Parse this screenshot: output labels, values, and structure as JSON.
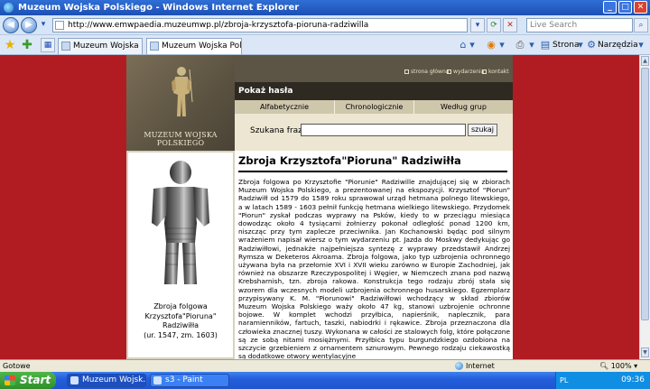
{
  "window": {
    "title": "Muzeum Wojska Polskiego - Windows Internet Explorer"
  },
  "address": {
    "url": "http://www.emwpaedia.muzeumwp.pl/zbroja-krzysztofa-pioruna-radziwilla",
    "search_placeholder": "Live Search"
  },
  "tabs": [
    {
      "label": "Muzeum Wojska Po..."
    },
    {
      "label": "Muzeum Wojska Polski..."
    }
  ],
  "toolbar": {
    "page_label": "Strona",
    "tools_label": "Narzędzia"
  },
  "site": {
    "logo_text": "MUZEUM WOJSKA POLSKIEGO",
    "top_links": [
      "strona główna",
      "wydarzenia",
      "kontakt"
    ],
    "section_header": "Pokaż hasła",
    "filters": [
      "Alfabetycznie",
      "Chronologicznie",
      "Według grup tematycznych"
    ],
    "search_label": "Szukana fraza:",
    "search_button": "szukaj",
    "image_caption_1": "Zbroja folgowa",
    "image_caption_2": "Krzysztofa\"Pioruna\" Radziwiłła",
    "image_caption_3": "(ur. 1547, zm. 1603)",
    "article_title": "Zbroja Krzysztofa\"Pioruna\" Radziwiłła",
    "article_body": "Zbroja folgowa po Krzysztofie \"Piorunie\" Radziwille znajdującej się w zbiorach Muzeum Wojska Polskiego, a prezentowanej na ekspozycji. Krzysztof \"Piorun\" Radziwiłł od 1579 do 1589 roku sprawował urząd hetmana polnego litewskiego, a w latach 1589 - 1603 pełnił funkcję hetmana wielkiego litewskiego. Przydomek \"Piorun\" zyskał podczas wyprawy na Psków, kiedy to w przeciągu miesiąca dowodząc około 4 tysiącami żołnierzy pokonał odległość ponad 1200 km, niszcząc przy tym zaplecze przeciwnika. Jan Kochanowski będąc pod silnym wrażeniem napisał wiersz o tym wydarzeniu pt. Jazda do Moskwy dedykując go Radziwiłłowi, jednakże najpełniejsza syntezę z wyprawy przedstawił Andrzej Rymsza w Deketeros Akroama. Zbroja folgowa, jako typ uzbrojenia ochronnego używana była na przełomie XVI i XVII wieku zarówno w Europie Zachodniej, jak również na obszarze Rzeczypospolitej i Węgier, w Niemczech znana pod nazwą Krebsharnish, tzn. zbroja rakowa. Konstrukcja tego rodzaju zbrój stała się wzorem dla wczesnych modeli uzbrojenia ochronnego husarskiego. Egzemplarz przypisywany K. M. \"Piorunowi\" Radziwiłłowi wchodzący w skład zbiorów Muzeum Wojska Polskiego waży około 47 kg, stanowi uzbrojenie ochronne bojowe. W komplet wchodzi przyłbica, napierśnik, naplecznik, para naramienników, fartuch, taszki, nabiodrki i rękawice. Zbroja przeznaczona dla człowieka znacznej tuszy. Wykonana w całości ze stalowych folg, które połączone są ze sobą nitami mosiężnymi. Przyłbica typu burgundzkiego ozdobiona na szczycie grzebieniem z ornamentem sznurowym. Pewnego rodzaju ciekawostką są dodatkowe otwory wentylacyjne"
  },
  "status": {
    "text": "Gotowe",
    "zone": "Internet",
    "zoom": "100%"
  },
  "taskbar": {
    "start_label": "Start",
    "tasks": [
      {
        "label": "Muzeum Wojsk..."
      },
      {
        "label": "s3 - Paint"
      }
    ],
    "lang": "PL",
    "clock": "09:36"
  }
}
